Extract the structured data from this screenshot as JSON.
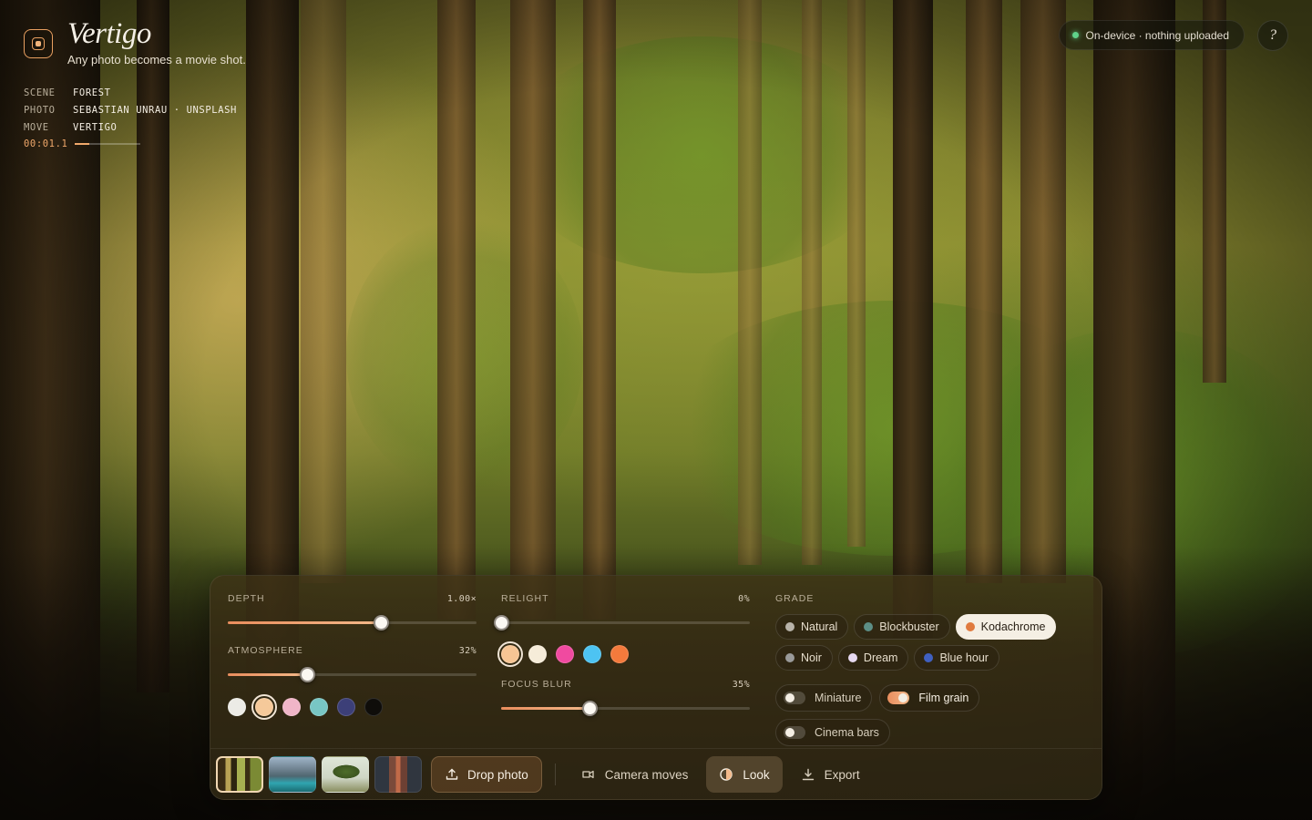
{
  "app": {
    "title": "Vertigo",
    "tagline": "Any photo becomes a movie shot."
  },
  "meta": [
    {
      "key": "SCENE",
      "value": "FOREST"
    },
    {
      "key": "PHOTO",
      "value": "SEBASTIAN UNRAU · UNSPLASH"
    },
    {
      "key": "MOVE",
      "value": "VERTIGO"
    }
  ],
  "timecode": {
    "value": "00:01.1",
    "progress": 0.22
  },
  "status": {
    "text": "On-device · nothing uploaded",
    "color": "#5fd28a"
  },
  "help": {
    "label": "?"
  },
  "controls": {
    "depth": {
      "label": "DEPTH",
      "value_text": "1.00×",
      "fraction": 0.615
    },
    "atmosphere": {
      "label": "ATMOSPHERE",
      "value_text": "32%",
      "fraction": 0.32,
      "swatches": [
        {
          "color": "#ecebe6",
          "selected": false
        },
        {
          "color": "#f5c99a",
          "selected": true
        },
        {
          "color": "#f0b5c8",
          "selected": false
        },
        {
          "color": "#78c6c4",
          "selected": false
        },
        {
          "color": "#3c3f78",
          "selected": false
        },
        {
          "color": "#0f0d0a",
          "selected": false
        }
      ]
    },
    "relight": {
      "label": "RELIGHT",
      "value_text": "0%",
      "fraction": 0.0,
      "swatches": [
        {
          "color": "#f6c594",
          "selected": true
        },
        {
          "color": "#f6ecd9",
          "selected": false
        },
        {
          "color": "#f04aa0",
          "selected": false
        },
        {
          "color": "#4dc3f2",
          "selected": false
        },
        {
          "color": "#f47a3c",
          "selected": false
        }
      ]
    },
    "focus_blur": {
      "label": "FOCUS BLUR",
      "value_text": "35%",
      "fraction": 0.355
    }
  },
  "grade": {
    "label": "GRADE",
    "options": [
      {
        "label": "Natural",
        "color": "#b8b3aa",
        "selected": false
      },
      {
        "label": "Blockbuster",
        "color": "#5d8f86",
        "selected": false
      },
      {
        "label": "Kodachrome",
        "color": "#e07a3e",
        "selected": true
      },
      {
        "label": "Noir",
        "color": "#9a9a9a",
        "selected": false
      },
      {
        "label": "Dream",
        "color": "#e6d8f0",
        "selected": false
      },
      {
        "label": "Blue hour",
        "color": "#4060c0",
        "selected": false
      }
    ],
    "toggles": [
      {
        "label": "Miniature",
        "on": false
      },
      {
        "label": "Film grain",
        "on": true
      },
      {
        "label": "Cinema bars",
        "on": false
      }
    ]
  },
  "bottom": {
    "thumbnails": [
      {
        "name": "forest",
        "selected": true
      },
      {
        "name": "lake",
        "selected": false
      },
      {
        "name": "tree",
        "selected": false
      },
      {
        "name": "canyon",
        "selected": false
      }
    ],
    "drop_photo": "Drop photo",
    "camera_moves": "Camera moves",
    "look": "Look",
    "export": "Export",
    "active_tab": "look"
  },
  "colors": {
    "accent": "#f0a86b",
    "brand_ring": "#e9a061"
  }
}
